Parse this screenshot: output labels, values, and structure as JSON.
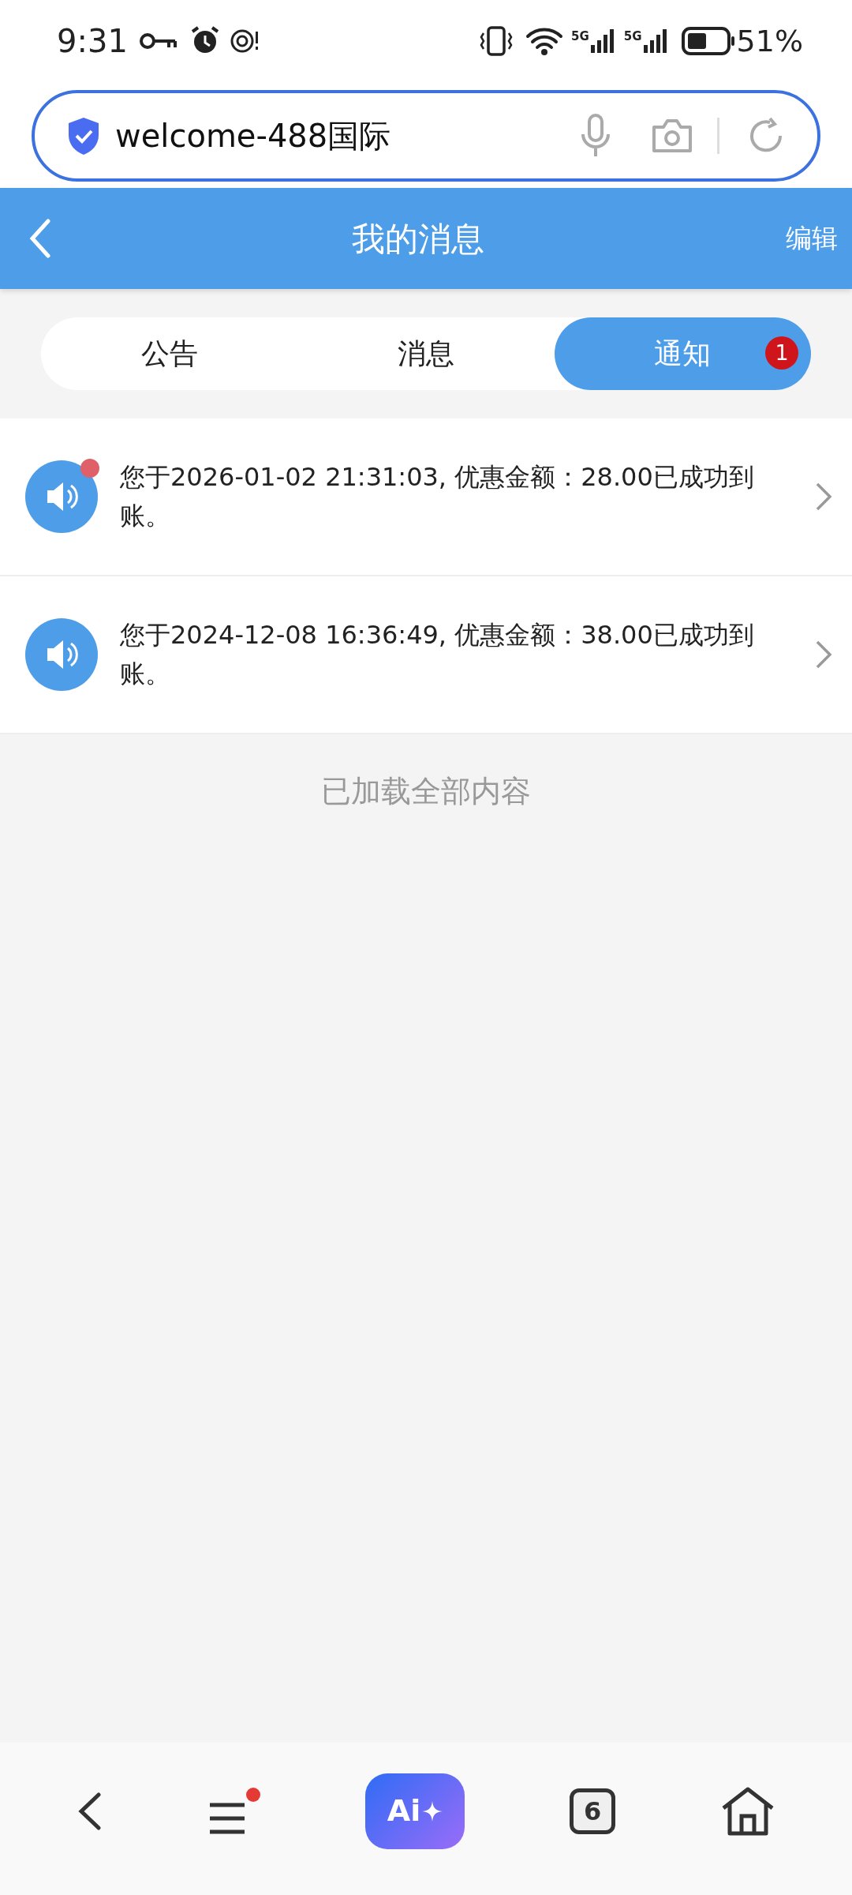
{
  "status_bar": {
    "time": "9:31",
    "network_labels": [
      "5G",
      "5G"
    ],
    "battery": "51%"
  },
  "address_bar": {
    "url": "welcome-488国际"
  },
  "header": {
    "title": "我的消息",
    "action": "编辑"
  },
  "tabs": [
    {
      "label": "公告",
      "selected": false
    },
    {
      "label": "消息",
      "selected": false
    },
    {
      "label": "通知",
      "selected": true,
      "badge": "1"
    }
  ],
  "messages": [
    {
      "text": "您于2026-01-02 21:31:03, 优惠金额：28.00已成功到账。",
      "unread": true
    },
    {
      "text": "您于2024-12-08 16:36:49, 优惠金额：38.00已成功到账。",
      "unread": false
    }
  ],
  "footer_text": "已加载全部内容",
  "bottom_nav": {
    "menu_dot": true,
    "ai_label": "Ai",
    "tab_count": "6"
  }
}
